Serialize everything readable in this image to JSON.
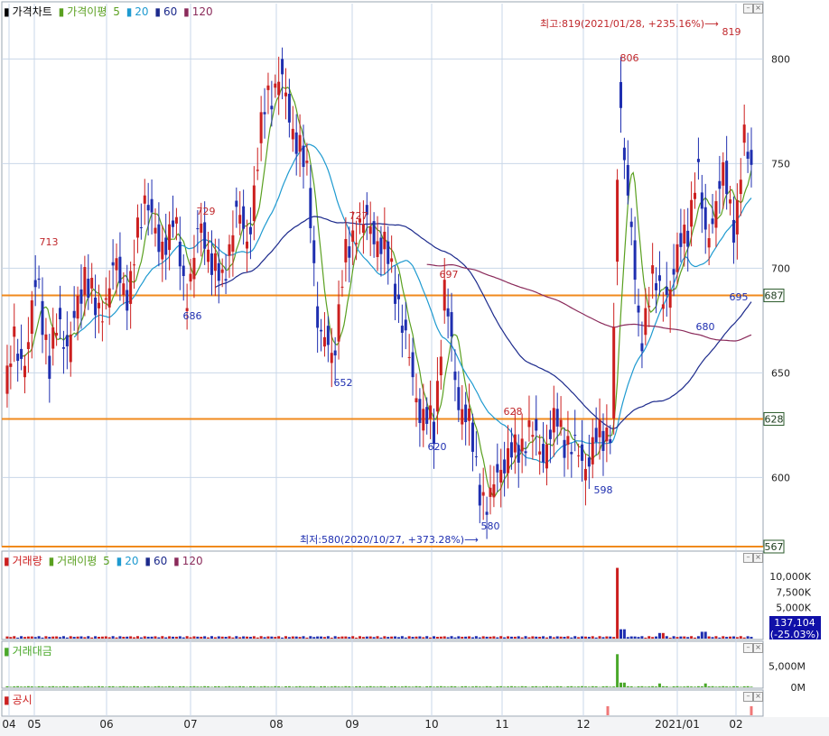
{
  "chart_data": [
    {
      "type": "candlestick",
      "legend": {
        "title": "가격차트",
        "ma_label": "가격이평",
        "periods": [
          "5",
          "20",
          "60",
          "120"
        ]
      },
      "y_ticks": [
        600,
        650,
        700,
        750,
        800
      ],
      "ylim": [
        567,
        826
      ],
      "grid": true,
      "levels": [
        {
          "value": 687,
          "label": "687",
          "color": "#f08a1c"
        },
        {
          "value": 628,
          "label": "628",
          "color": "#f08a1c"
        },
        {
          "value": 567,
          "label": "567",
          "color": "#f08a1c"
        }
      ],
      "high_note": "최고:819(2021/01/28, +235.16%)⟶",
      "low_note": "최저:580(2020/10/27, +373.28%)⟶",
      "peak_labels": [
        {
          "value": "713",
          "kind": "high"
        },
        {
          "value": "686",
          "kind": "low"
        },
        {
          "value": "729",
          "kind": "high"
        },
        {
          "value": "727",
          "kind": "high"
        },
        {
          "value": "652",
          "kind": "low"
        },
        {
          "value": "697",
          "kind": "high"
        },
        {
          "value": "620",
          "kind": "low"
        },
        {
          "value": "628",
          "kind": "high"
        },
        {
          "value": "580",
          "kind": "low"
        },
        {
          "value": "598",
          "kind": "low"
        },
        {
          "value": "806",
          "kind": "high"
        },
        {
          "value": "680",
          "kind": "low"
        },
        {
          "value": "819",
          "kind": "high"
        },
        {
          "value": "695",
          "kind": "low"
        }
      ],
      "ma_colors": {
        "5": "#5aa020",
        "20": "#1e9ad0",
        "60": "#1c2a8c",
        "120": "#8a2a5a"
      },
      "up_color": "#cc1f1f",
      "down_color": "#1f2fb0"
    },
    {
      "type": "bar",
      "legend": {
        "title": "거래량",
        "ma_label": "거래이평",
        "periods": [
          "5",
          "20",
          "60",
          "120"
        ]
      },
      "y_ticks": [
        "10,000K",
        "7,500K",
        "5,000K"
      ],
      "y_tick_values": [
        10000,
        7500,
        5000
      ],
      "ymax": 12500,
      "current_value": "137,104",
      "current_change": "(-25.03%)"
    },
    {
      "type": "bar",
      "legend": {
        "title": "거래대금"
      },
      "y_ticks": [
        "5,000M",
        "0M"
      ],
      "y_tick_values": [
        5000,
        0
      ],
      "ymax": 8500
    },
    {
      "type": "event",
      "legend": {
        "title": "공시"
      }
    }
  ],
  "x_axis": {
    "labels": [
      "04",
      "05",
      "06",
      "07",
      "08",
      "09",
      "10",
      "11",
      "12",
      "2021/01",
      "02"
    ]
  },
  "colors": {
    "grid": "#c9d7e8",
    "level_line": "#f08a1c",
    "note_red": "#c0282c",
    "note_blue": "#1f2fb0",
    "volume_green": "#4aa82a"
  }
}
